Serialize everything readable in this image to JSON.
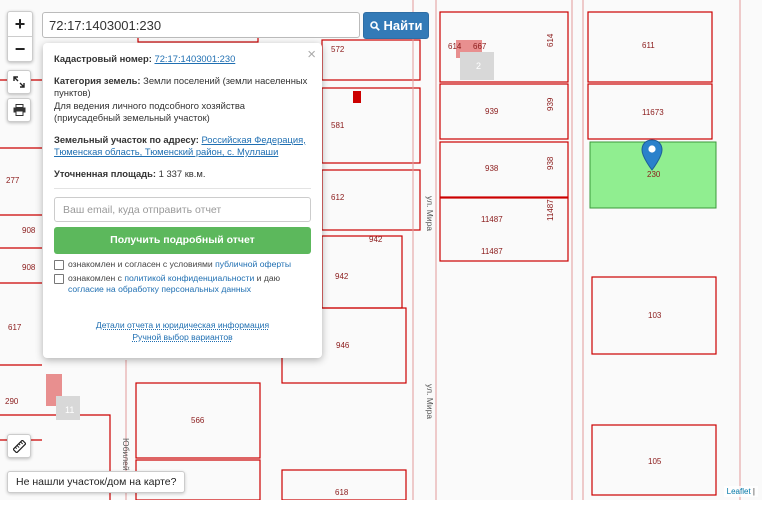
{
  "search": {
    "value": "72:17:1403001:230",
    "button_label": "Найти"
  },
  "zoom": {
    "in": "+",
    "out": "−"
  },
  "popup": {
    "cadastral_label": "Кадастровый номер:",
    "cadastral_value": "72:17:1403001:230",
    "category_label": "Категория земель:",
    "category_value": "Земли поселений (земли населенных пунктов)",
    "usage_value": "Для ведения личного подсобного хозяйства (приусадебный земельный участок)",
    "address_label": "Земельный участок по адресу:",
    "address_value": "Российская Федерация, Тюменская область, Тюменский район, с. Муллаши",
    "area_label": "Уточненная площадь:",
    "area_value": "1 337 кв.м.",
    "email_placeholder": "Ваш email, куда отправить отчет",
    "report_button": "Получить подробный отчет",
    "consent1_text": "ознакомлен и согласен с условиями",
    "consent1_link": "публичной оферты",
    "consent2_text": "ознакомлен с",
    "consent2_link1": "политикой конфиденциальности",
    "consent2_mid": "и даю",
    "consent2_link2": "согласие на обработку персональных данных",
    "details_link": "Детали отчета и юридическая информация",
    "manual_link": "Ручной выбор вариантов",
    "close": "×"
  },
  "not_found_button": "Не нашли участок/дом на карте?",
  "attribution": {
    "leaflet": "Leaflet",
    "sep": "|"
  },
  "map": {
    "parcel_labels": [
      "572",
      "614",
      "667",
      "614",
      "611",
      "2",
      "939",
      "939",
      "11673",
      "581",
      "230",
      "938",
      "938",
      "277",
      "612",
      "11487",
      "11487",
      "11487",
      "908",
      "942",
      "908",
      "942",
      "617",
      "946",
      "103",
      "290",
      "11",
      "566",
      "105",
      "618",
      "ул. Мира",
      "ул. Мира",
      "Юбилейн..."
    ]
  },
  "colors": {
    "parcel_line": "#cc0000",
    "selected_fill": "#90ee90",
    "selected_stroke": "#3a9a3a",
    "marker": "#2a81cb",
    "find_button": "#337ab7",
    "report_button": "#5cb85c"
  }
}
